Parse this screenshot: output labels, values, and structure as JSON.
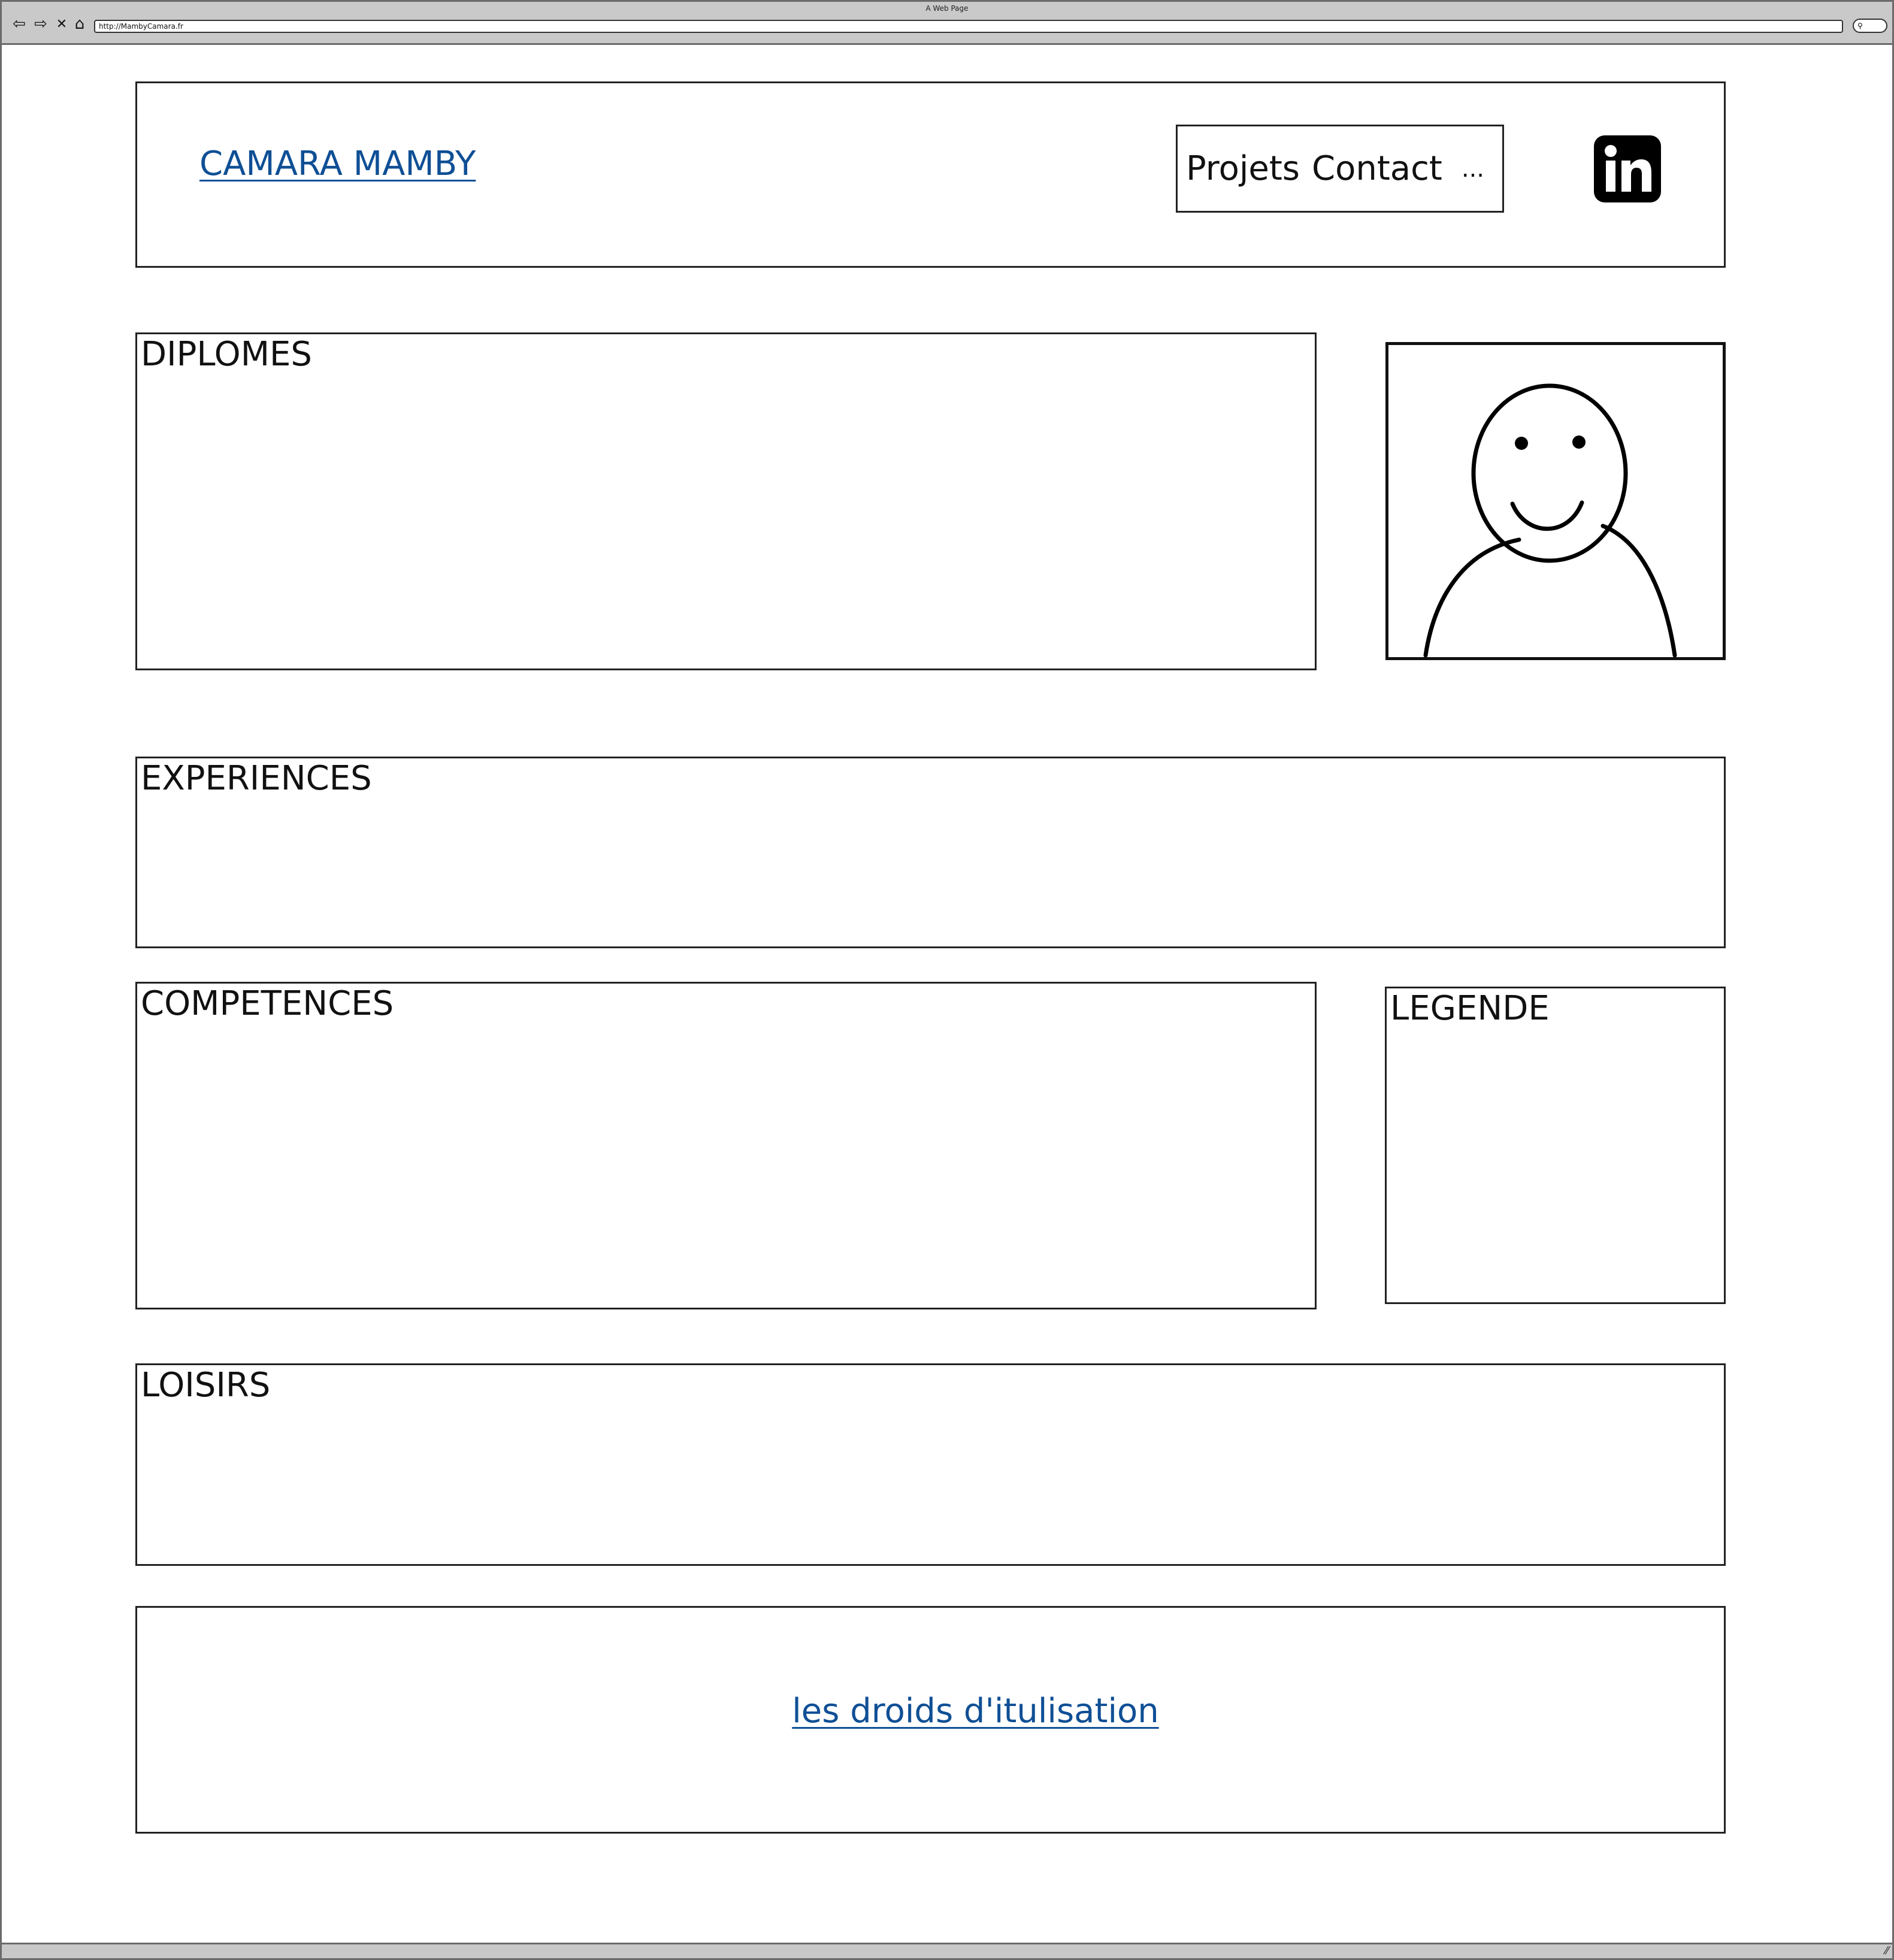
{
  "browser": {
    "window_title": "A Web Page",
    "url": "http://MambyCamara.fr",
    "back_glyph": "⇦",
    "forward_glyph": "⇨",
    "stop_glyph": "✕",
    "home_glyph": "⌂",
    "search_glyph": "⚲"
  },
  "header": {
    "site_name": "CAMARA MAMBY",
    "menu": {
      "items": [
        "Projets",
        "Contact"
      ],
      "more": "..."
    },
    "social_icon": "linkedin-icon"
  },
  "sections": {
    "diplomes": "DIPLOMES",
    "experiences": "EXPERIENCES",
    "competences": "COMPETENCES",
    "legende": "LEGENDE",
    "loisirs": "LOISIRS"
  },
  "profile_image": "user-avatar-icon",
  "footer": {
    "link": "les droids d'itulisation"
  },
  "colors": {
    "link": "#0f4f95",
    "border": "#222222",
    "chrome": "#c9c9c9"
  }
}
